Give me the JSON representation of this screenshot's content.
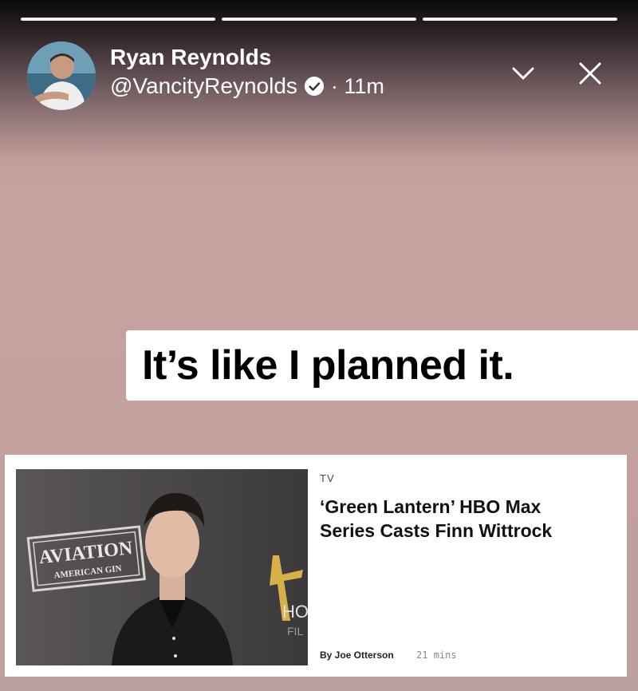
{
  "story": {
    "progress_segments": [
      "done",
      "done",
      "done"
    ]
  },
  "header": {
    "author_name": "Ryan Reynolds",
    "handle": "@VancityReynolds",
    "time": "· 11m",
    "icons": [
      "avatar",
      "verified-badge-icon",
      "chevron-down-icon",
      "close-icon"
    ]
  },
  "caption": {
    "text": "It’s like I planned it."
  },
  "article_card": {
    "category": "TV",
    "headline": "‘Green Lantern’ HBO Max Series Casts Finn Wittrock",
    "byline": "By Joe Otterson",
    "time": "21 mins",
    "image_signage": {
      "brand_line_1": "AVIATION",
      "brand_line_2": "AMERICAN GIN",
      "backdrop_text": "HO",
      "backdrop_text_2": "FIL"
    }
  },
  "colors": {
    "background_top": "#0c0b0c",
    "background_main": "#c9a3a1",
    "caption_bg": "#ffffff",
    "card_bg": "#ffffff"
  }
}
